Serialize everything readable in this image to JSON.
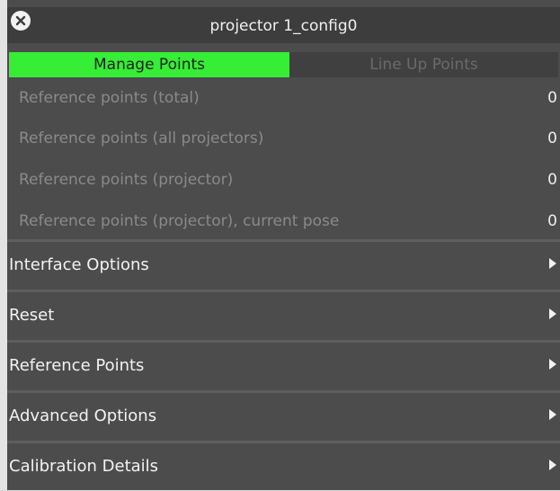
{
  "window": {
    "title": "projector 1_config0",
    "close_icon": "close-icon"
  },
  "tabs": [
    {
      "label": "Manage Points",
      "active": true
    },
    {
      "label": "Line Up Points",
      "active": false
    }
  ],
  "stats": [
    {
      "label": "Reference points (total)",
      "value": "0"
    },
    {
      "label": "Reference points (all projectors)",
      "value": "0"
    },
    {
      "label": "Reference points (projector)",
      "value": "0"
    },
    {
      "label": "Reference points (projector), current pose",
      "value": "0"
    }
  ],
  "sections": [
    {
      "label": "Interface Options",
      "icon": "triangle-right-icon"
    },
    {
      "label": "Reset",
      "icon": "triangle-right-icon"
    },
    {
      "label": "Reference Points",
      "icon": "triangle-right-icon"
    },
    {
      "label": "Advanced Options",
      "icon": "triangle-right-icon"
    },
    {
      "label": "Calibration Details",
      "icon": "triangle-right-icon"
    }
  ],
  "colors": {
    "panel_bg": "#4c4c4c",
    "titlebar_bg": "#3d3d3d",
    "active_tab": "#36ee36",
    "inactive_tab": "#404040",
    "muted_text": "#8a8a8a"
  }
}
